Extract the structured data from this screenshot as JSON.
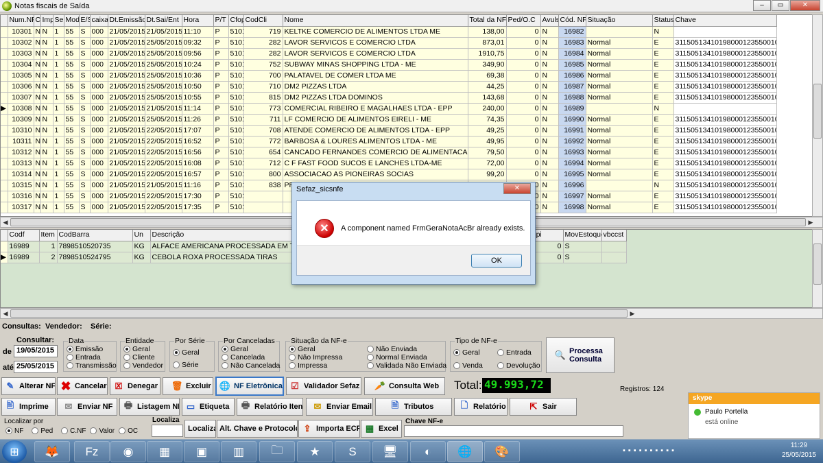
{
  "window": {
    "title": "Notas fiscais de Saída"
  },
  "main_grid": {
    "columns": [
      "Num.NF",
      "Ca",
      "Imp",
      "Serie",
      "Mod",
      "E/S",
      "caixa",
      "Dt.Emissão",
      "Dt.Sai/Ent",
      "Hora",
      "P/T",
      "Cfop",
      "CodCli",
      "Nome",
      "Total da NF",
      "Ped/O.C",
      "Avulsa",
      "Cód. NF",
      "Situação",
      "Status",
      "Chave"
    ],
    "rows": [
      [
        "10301",
        "N",
        "N",
        "1",
        "55",
        "S",
        "000",
        "21/05/2015",
        "21/05/2015",
        "11:10",
        "P",
        "5101",
        "719",
        "KELTKE COMERCIO DE ALIMENTOS LTDA ME",
        "138,00",
        "0",
        "N",
        "16982",
        "",
        "N",
        ""
      ],
      [
        "10302",
        "N",
        "N",
        "1",
        "55",
        "S",
        "000",
        "21/05/2015",
        "25/05/2015",
        "09:32",
        "P",
        "5101",
        "282",
        "LAVOR SERVICOS E COMERCIO LTDA",
        "873,01",
        "0",
        "N",
        "16983",
        "Normal",
        "E",
        "31150513410198000123550010000"
      ],
      [
        "10303",
        "N",
        "N",
        "1",
        "55",
        "S",
        "000",
        "21/05/2015",
        "25/05/2015",
        "09:56",
        "P",
        "5101",
        "282",
        "LAVOR SERVICOS E COMERCIO LTDA",
        "1910,75",
        "0",
        "N",
        "16984",
        "Normal",
        "E",
        "31150513410198000123550010000"
      ],
      [
        "10304",
        "N",
        "N",
        "1",
        "55",
        "S",
        "000",
        "21/05/2015",
        "25/05/2015",
        "10:24",
        "P",
        "5101",
        "752",
        "SUBWAY MINAS SHOPPING LTDA - ME",
        "349,90",
        "0",
        "N",
        "16985",
        "Normal",
        "E",
        "31150513410198000123550010000"
      ],
      [
        "10305",
        "N",
        "N",
        "1",
        "55",
        "S",
        "000",
        "21/05/2015",
        "25/05/2015",
        "10:36",
        "P",
        "5101",
        "700",
        "PALATAVEL DE COMER LTDA ME",
        "69,38",
        "0",
        "N",
        "16986",
        "Normal",
        "E",
        "31150513410198000123550010000"
      ],
      [
        "10306",
        "N",
        "N",
        "1",
        "55",
        "S",
        "000",
        "21/05/2015",
        "25/05/2015",
        "10:50",
        "P",
        "5101",
        "710",
        "DM2 PIZZAS LTDA",
        "44,25",
        "0",
        "N",
        "16987",
        "Normal",
        "E",
        "31150513410198000123550010000"
      ],
      [
        "10307",
        "N",
        "N",
        "1",
        "55",
        "S",
        "000",
        "21/05/2015",
        "25/05/2015",
        "10:55",
        "P",
        "5101",
        "815",
        "DM2 PIZZAS LTDA DOMINOS",
        "143,68",
        "0",
        "N",
        "16988",
        "Normal",
        "E",
        "31150513410198000123550010000"
      ],
      [
        "10308",
        "N",
        "N",
        "1",
        "55",
        "S",
        "000",
        "21/05/2015",
        "21/05/2015",
        "11:14",
        "P",
        "5101",
        "773",
        "COMERCIAL RIBEIRO E MAGALHAES LTDA - EPP",
        "240,00",
        "0",
        "N",
        "16989",
        "",
        "N",
        ""
      ],
      [
        "10309",
        "N",
        "N",
        "1",
        "55",
        "S",
        "000",
        "21/05/2015",
        "25/05/2015",
        "11:26",
        "P",
        "5101",
        "711",
        "LF COMERCIO DE ALIMENTOS EIRELI - ME",
        "74,35",
        "0",
        "N",
        "16990",
        "Normal",
        "E",
        "31150513410198000123550010000"
      ],
      [
        "10310",
        "N",
        "N",
        "1",
        "55",
        "S",
        "000",
        "21/05/2015",
        "22/05/2015",
        "17:07",
        "P",
        "5101",
        "708",
        "ATENDE COMERCIO DE ALIMENTOS LTDA - EPP",
        "49,25",
        "0",
        "N",
        "16991",
        "Normal",
        "E",
        "31150513410198000123550010000"
      ],
      [
        "10311",
        "N",
        "N",
        "1",
        "55",
        "S",
        "000",
        "21/05/2015",
        "22/05/2015",
        "16:52",
        "P",
        "5101",
        "772",
        "BARBOSA & LOURES ALIMENTOS LTDA - ME",
        "49,95",
        "0",
        "N",
        "16992",
        "Normal",
        "E",
        "31150513410198000123550010000"
      ],
      [
        "10312",
        "N",
        "N",
        "1",
        "55",
        "S",
        "000",
        "21/05/2015",
        "22/05/2015",
        "16:56",
        "P",
        "5101",
        "654",
        "CANCADO FERNANDES COMERCIO DE ALIMENTACAO EIRI",
        "79,50",
        "0",
        "N",
        "16993",
        "Normal",
        "E",
        "31150513410198000123550010000"
      ],
      [
        "10313",
        "N",
        "N",
        "1",
        "55",
        "S",
        "000",
        "21/05/2015",
        "22/05/2015",
        "16:08",
        "P",
        "5101",
        "712",
        "C F FAST FOOD SUCOS E LANCHES LTDA-ME",
        "72,00",
        "0",
        "N",
        "16994",
        "Normal",
        "E",
        "31150513410198000123550010000"
      ],
      [
        "10314",
        "N",
        "N",
        "1",
        "55",
        "S",
        "000",
        "21/05/2015",
        "22/05/2015",
        "16:57",
        "P",
        "5101",
        "800",
        "ASSOCIACAO AS PIONEIRAS SOCIAS",
        "99,20",
        "0",
        "N",
        "16995",
        "Normal",
        "E",
        "31150513410198000123550010000"
      ],
      [
        "10315",
        "N",
        "N",
        "1",
        "55",
        "S",
        "000",
        "21/05/2015",
        "21/05/2015",
        "11:16",
        "P",
        "5101",
        "838",
        "PRM1 ALIMENTOS LTDA ME",
        "85,81",
        "0",
        "N",
        "16996",
        "",
        "N",
        "31150513410198000123550010000"
      ],
      [
        "10316",
        "N",
        "N",
        "1",
        "55",
        "S",
        "000",
        "21/05/2015",
        "22/05/2015",
        "17:30",
        "P",
        "5101",
        "",
        "",
        "",
        "0",
        "N",
        "16997",
        "Normal",
        "E",
        "31150513410198000123550010000"
      ],
      [
        "10317",
        "N",
        "N",
        "1",
        "55",
        "S",
        "000",
        "21/05/2015",
        "22/05/2015",
        "17:35",
        "P",
        "5101",
        "",
        "",
        "",
        "0",
        "N",
        "16998",
        "Normal",
        "E",
        "31150513410198000123550010000"
      ]
    ]
  },
  "items_grid": {
    "columns": [
      "Codf",
      "Item",
      "CodBarra",
      "Un",
      "Descrição",
      "Cst",
      "Cfop",
      "MVA",
      "%Icm",
      "vbc",
      "vicms",
      "%.Ipi",
      "Vlr.Ipi",
      "MovEstoque",
      "vbccst"
    ],
    "rows": [
      [
        "16989",
        "1",
        "7898510520735",
        "KG",
        "ALFACE AMERICANA PROCESSADA EM TIRA",
        "040",
        "5101",
        "0",
        "0",
        "0,00",
        "0,00",
        "0",
        "0",
        "S",
        ""
      ],
      [
        "16989",
        "2",
        "7898510524795",
        "KG",
        "CEBOLA ROXA PROCESSADA TIRAS",
        "040",
        "5101",
        "0",
        "0",
        "0,00",
        "0,00",
        "0",
        "0",
        "S",
        ""
      ]
    ]
  },
  "consultas": {
    "label": "Consultas:",
    "vendedor": "Vendedor:",
    "serie": "Série:"
  },
  "consultar": {
    "label": "Consultar:",
    "de_label": "de",
    "ate_label": "até",
    "de": "19/05/2015",
    "ate": "25/05/2015"
  },
  "filters": {
    "data": {
      "title": "Data",
      "options": [
        "Emissão",
        "Entrada",
        "Transmissão"
      ]
    },
    "entidade": {
      "title": "Entidade",
      "options": [
        "Geral",
        "Cliente",
        "Vendedor"
      ]
    },
    "por_serie": {
      "title": "Por Série",
      "options": [
        "Geral",
        "Série"
      ]
    },
    "por_canceladas": {
      "title": "Por Canceladas",
      "options": [
        "Geral",
        "Cancelada",
        "Não Cancelada"
      ]
    },
    "situacao": {
      "title": "Situação da NF-e",
      "options": [
        "Geral",
        "Não Impressa",
        "Impressa",
        "Não Enviada",
        "Normal Enviada",
        "Validada Não Enviada"
      ]
    },
    "tipo": {
      "title": "Tipo de NF-e",
      "options": [
        "Geral",
        "Entrada",
        "Venda",
        "Devolução"
      ]
    }
  },
  "buttons": {
    "processa": "Processa Consulta",
    "alterar": "Alterar NF",
    "cancelar": "Cancelar",
    "denegar": "Denegar",
    "excluir": "Excluir",
    "nf_eletronica": "NF Eletrônica",
    "validador": "Validador Sefaz",
    "consulta_web": "Consulta Web",
    "imprime": "Imprime",
    "enviar_nf": "Enviar NF",
    "listagem": "Listagem NF",
    "etiqueta": "Etiqueta",
    "relatorio_itens": "Relatório Itens",
    "enviar_email": "Enviar Email",
    "tributos": "Tributos",
    "relatorio": "Relatório",
    "sair": "Sair",
    "localiza": "Localiza",
    "alt_chave": "Alt. Chave e Protocolo",
    "importa_ecf": "Importa ECF",
    "excel": "Excel"
  },
  "total": {
    "label": "Total:",
    "value": "49.993,72"
  },
  "registros": "Registros: 124",
  "localizar": {
    "label": "Localizar por",
    "localiza_label": "Localiza",
    "chave_label": "Chave NF-e",
    "options": [
      "NF",
      "Ped",
      "C.NF",
      "Valor",
      "OC"
    ]
  },
  "dialog": {
    "title": "Sefaz_sicsnfe",
    "message": "A component named FrmGeraNotaAcBr already exists.",
    "ok": "OK"
  },
  "skype": {
    "brand": "skype",
    "name": "Paulo Portella",
    "status": "está online"
  },
  "clock": {
    "time": "11:29",
    "date": "25/05/2015"
  }
}
